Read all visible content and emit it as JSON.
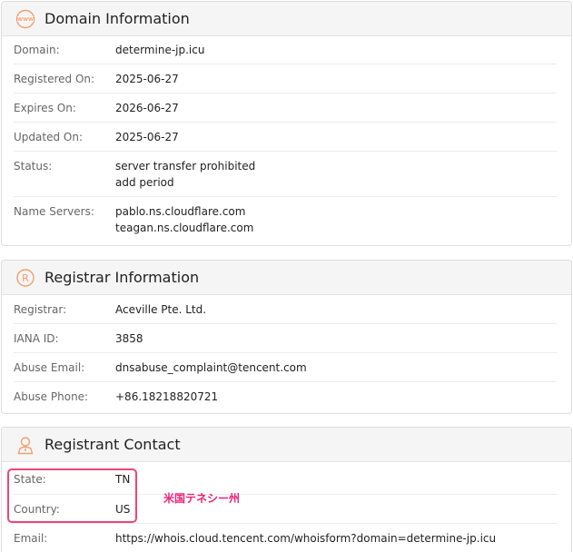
{
  "domain_info": {
    "title": "Domain Information",
    "icon_label": "WWW",
    "rows": [
      {
        "label": "Domain:",
        "value": "determine-jp.icu"
      },
      {
        "label": "Registered On:",
        "value": "2025-06-27"
      },
      {
        "label": "Expires On:",
        "value": "2026-06-27"
      },
      {
        "label": "Updated On:",
        "value": "2025-06-27"
      },
      {
        "label": "Status:",
        "values": [
          "server transfer prohibited",
          "add period"
        ]
      },
      {
        "label": "Name Servers:",
        "values": [
          "pablo.ns.cloudflare.com",
          "teagan.ns.cloudflare.com"
        ]
      }
    ]
  },
  "registrar_info": {
    "title": "Registrar Information",
    "icon_label": "R",
    "rows": [
      {
        "label": "Registrar:",
        "value": "Aceville Pte. Ltd."
      },
      {
        "label": "IANA ID:",
        "value": "3858"
      },
      {
        "label": "Abuse Email:",
        "value": "dnsabuse_complaint@tencent.com"
      },
      {
        "label": "Abuse Phone:",
        "value": "+86.18218820721"
      }
    ]
  },
  "registrant_contact": {
    "title": "Registrant Contact",
    "rows": [
      {
        "label": "State:",
        "value": "TN"
      },
      {
        "label": "Country:",
        "value": "US"
      },
      {
        "label": "Email:",
        "value": "https://whois.cloud.tencent.com/whoisform?domain=determine-jp.icu"
      }
    ]
  },
  "annotation": {
    "text": "米国テネシー州",
    "color": "#ee2277"
  },
  "colors": {
    "accent": "#f0a070",
    "header_bg": "#f5f5f5",
    "annotation_border": "#ee4477"
  }
}
